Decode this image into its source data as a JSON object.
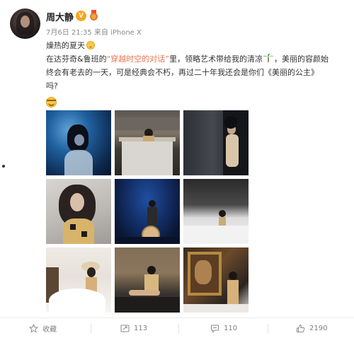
{
  "post": {
    "author": "周大静",
    "meta": "7月6日 21:35 来自 iPhone X",
    "title_line": "燥热的夏天",
    "body_lines": [
      [
        "在达芬奇&鲁班的",
        "“穿越时空的对话”",
        "里，领略艺术带给我的清凉",
        "，美丽的容颜始"
      ],
      [
        "终会有老去的一天，可是经典会不朽，再过二十年我还会是你们《美丽的公主》"
      ],
      [
        "吗?"
      ]
    ]
  },
  "photos": [
    {
      "icon": "photo-blue-portrait"
    },
    {
      "icon": "photo-gallery-table"
    },
    {
      "icon": "photo-wall-pose"
    },
    {
      "icon": "photo-hair-portrait"
    },
    {
      "icon": "photo-blue-stage-hat"
    },
    {
      "icon": "photo-white-stage"
    },
    {
      "icon": "photo-white-dress-hat"
    },
    {
      "icon": "photo-seated-mural"
    },
    {
      "icon": "photo-gold-frame-painting"
    }
  ],
  "actions": {
    "favorite": {
      "label": "收藏",
      "icon": "star-icon"
    },
    "repost": {
      "label": "113",
      "icon": "repost-icon"
    },
    "comment": {
      "label": "110",
      "icon": "comment-icon"
    },
    "like": {
      "label": "2190",
      "icon": "thumb-up-icon"
    }
  },
  "badges": {
    "verified": "V",
    "accent": "#eb7350",
    "vip_color": "#f5a623"
  }
}
